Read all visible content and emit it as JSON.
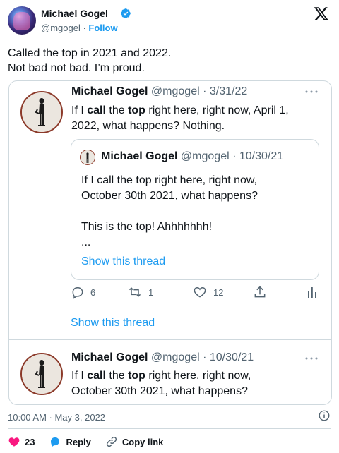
{
  "header": {
    "author_name": "Michael Gogel",
    "handle": "@mgogel",
    "separator": " · ",
    "follow_label": "Follow"
  },
  "tweet": {
    "text": "Called the top in 2021 and 2022.\nNot bad not bad. I’m proud."
  },
  "quote1": {
    "name": "Michael Gogel",
    "handle": "@mgogel",
    "date": "3/31/22",
    "text_parts": [
      "If I ",
      "call",
      " the ",
      "top",
      " right here, right now, April 1, 2022, what happens? Nothing."
    ],
    "inner": {
      "name": "Michael Gogel",
      "handle": "@mgogel",
      "date": "10/30/21",
      "text_line1": "If I call the top right here, right now,",
      "text_line2": "October 30th 2021, what happens?",
      "text_line3": "This is the top! Ahhhhhhh!",
      "ellipsis": "...",
      "show_thread": "Show this thread"
    },
    "actions": {
      "replies": "6",
      "retweets": "1",
      "likes": "12"
    },
    "show_thread": "Show this thread"
  },
  "quote2": {
    "name": "Michael Gogel",
    "handle": "@mgogel",
    "date": "10/30/21",
    "text_parts": [
      "If I ",
      "call",
      " the ",
      "top",
      " right here, right now,"
    ],
    "text_line2": "October 30th 2021, what happens?"
  },
  "footer": {
    "timestamp": "10:00 AM · May 3, 2022",
    "likes": "23",
    "reply_label": "Reply",
    "copy_label": "Copy link"
  },
  "icons": {
    "verified": "verified-badge-icon",
    "x_logo": "x-logo-icon",
    "reply": "reply-icon",
    "retweet": "retweet-icon",
    "like": "heart-icon",
    "share": "share-icon",
    "analytics": "analytics-icon",
    "info": "info-icon",
    "more": "more-dots-icon",
    "copy": "link-icon"
  },
  "colors": {
    "accent": "#1d9bf0",
    "like": "#f91880",
    "text": "#0f1419",
    "muted": "#536471",
    "border": "#cfd9de"
  }
}
